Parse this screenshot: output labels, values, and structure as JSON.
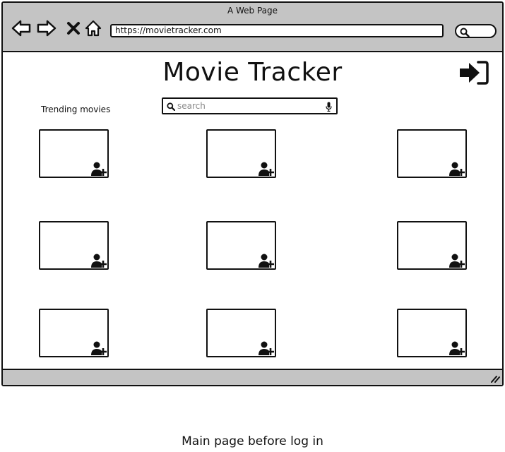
{
  "window": {
    "title": "A Web Page"
  },
  "address_bar": {
    "url": "https://movietracker.com"
  },
  "page": {
    "title": "Movie Tracker",
    "trending_label": "Trending movies",
    "search": {
      "placeholder": "search",
      "value": ""
    }
  },
  "icons": {
    "back": "arrow-left-icon",
    "forward": "arrow-right-icon",
    "stop": "close-icon",
    "home": "home-icon",
    "search": "search-icon",
    "mic": "microphone-icon",
    "login": "sign-in-icon",
    "add_user": "user-plus-icon",
    "resize": "resize-grip-icon"
  },
  "movie_count": 9,
  "caption": "Main page before log in"
}
